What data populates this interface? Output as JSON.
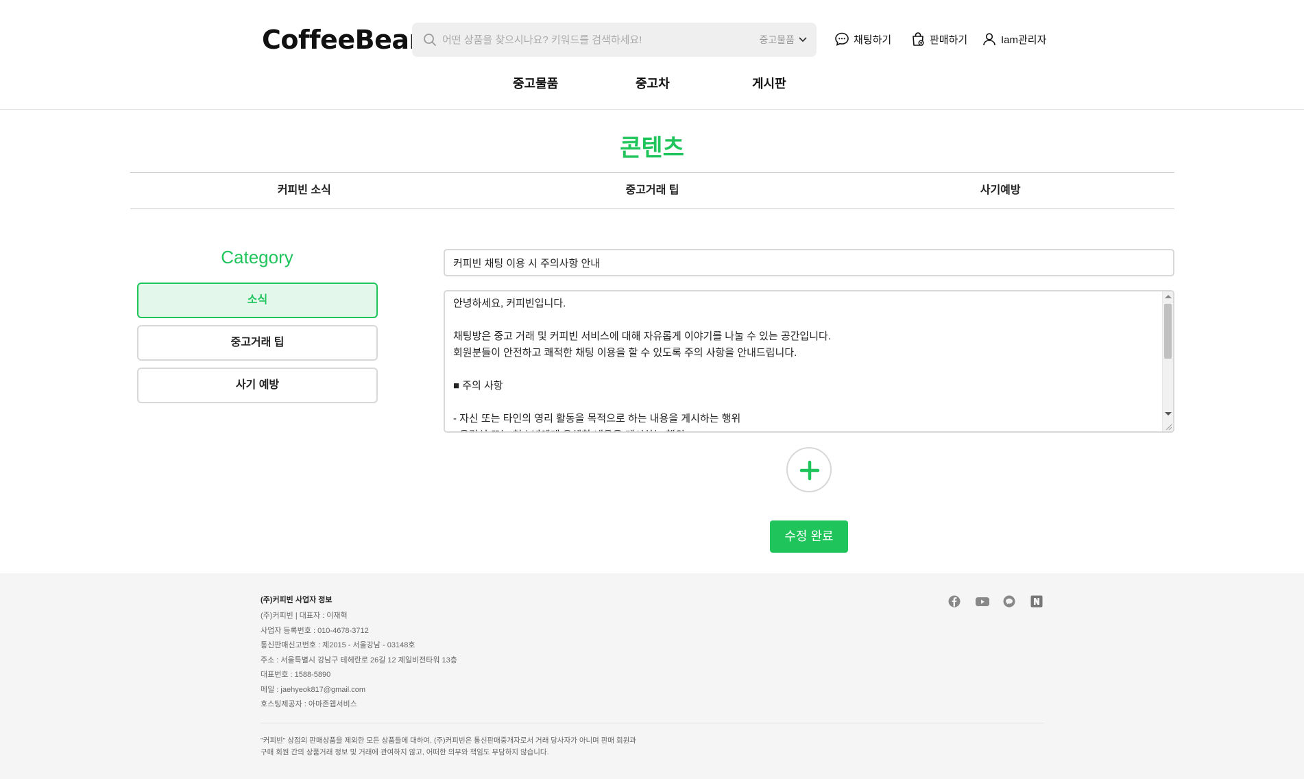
{
  "header": {
    "logo": "CoffeeBean",
    "search": {
      "placeholder": "어떤 상품을 찾으시나요? 키워드를 검색하세요!",
      "scope": "중고물품"
    },
    "chat": "채팅하기",
    "sell": "판매하기",
    "user": "Iam관리자",
    "nav": [
      "중고물품",
      "중고차",
      "게시판"
    ]
  },
  "content": {
    "title": "콘텐츠",
    "tabs": [
      "커피빈 소식",
      "중고거래 팁",
      "사기예방"
    ]
  },
  "category": {
    "title": "Category",
    "items": [
      "소식",
      "중고거래 팁",
      "사기 예방"
    ]
  },
  "editor": {
    "title_value": "커피빈 채팅 이용 시 주의사항 안내",
    "body_lines": [
      "안녕하세요, 커피빈입니다.",
      "",
      "채팅방은 중고 거래 및 커피빈 서비스에 대해 자유롭게 이야기를 나눌 수 있는 공간입니다.",
      "회원분들이 안전하고 쾌적한 채팅 이용을 할 수 있도록 주의 사항을 안내드립니다.",
      "",
      "■ 주의 사항",
      "",
      "- 자신 또는 타인의 영리 활동을 목적으로 하는 내용을 게시하는 행위",
      "- 음란성 또는 청소년에게 유해한 내용을 게시하는 행위"
    ],
    "save_label": "수정 완료"
  },
  "footer": {
    "heading": "(주)커피빈 사업자 정보",
    "lines": [
      "(주)커피빈 | 대표자 : 이재혁",
      "사업자 등록번호 : 010-4678-3712",
      "통신판매신고번호 : 제2015 - 서울강남 - 03148호",
      "주소 : 서울특별시 강남구 테헤란로 26길 12 제일비전타워 13층",
      "대표번호 : 1588-5890",
      "메일 : jaehyeok817@gmail.com",
      "호스팅제공자 : 아마존웹서비스"
    ],
    "disclaimer": [
      "\"커피빈\" 상점의 판매상품을 제외한 모든 상품들에 대하여, (주)커피빈은 통신판매중개자로서 거래 당사자가 아니며 판매 회원과",
      "구매 회원 간의 상품거래 정보 및 거래에 관여하지 않고, 어떠한 의무와 책임도 부담하지 않습니다."
    ],
    "social_icons": [
      "facebook-icon",
      "youtube-icon",
      "kakao-icon",
      "naver-icon"
    ]
  },
  "colors": {
    "accent": "#1fc45b",
    "accent_light": "#e3f8ea",
    "footer_bg": "#f5f5f5"
  }
}
